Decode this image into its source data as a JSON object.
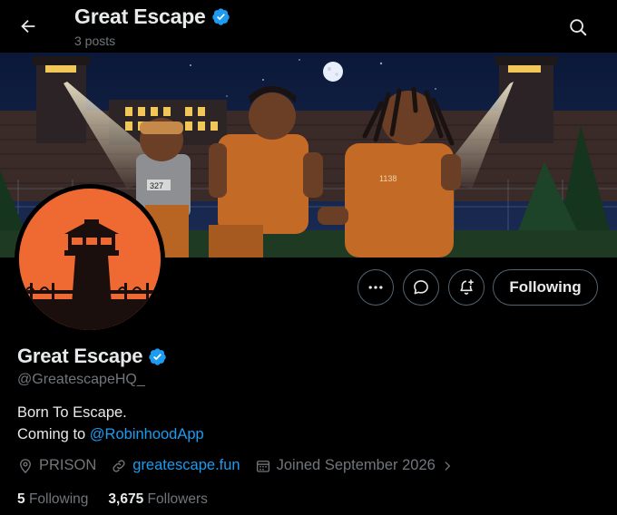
{
  "header": {
    "title": "Great Escape",
    "posts_count": "3 posts",
    "back_icon": "arrow-left-icon",
    "search_icon": "search-icon"
  },
  "profile": {
    "name": "Great Escape",
    "handle": "@GreatescapeHQ_",
    "verified_color": "#1d9bf0",
    "bio_line1": "Born To Escape.",
    "bio_line2_prefix": "Coming to ",
    "bio_mention": "@RobinhoodApp",
    "location": "PRISON",
    "website": "greatescape.fun",
    "joined": "Joined September 2026",
    "following_count": "5",
    "following_label": "Following",
    "followers_count": "3,675",
    "followers_label": "Followers"
  },
  "actions": {
    "more_icon": "more-icon",
    "message_icon": "message-icon",
    "notify_icon": "bell-plus-icon",
    "follow_button": "Following"
  },
  "colors": {
    "accent": "#1d9bf0",
    "muted": "#71767b",
    "avatar_bg": "#ee6a32"
  }
}
